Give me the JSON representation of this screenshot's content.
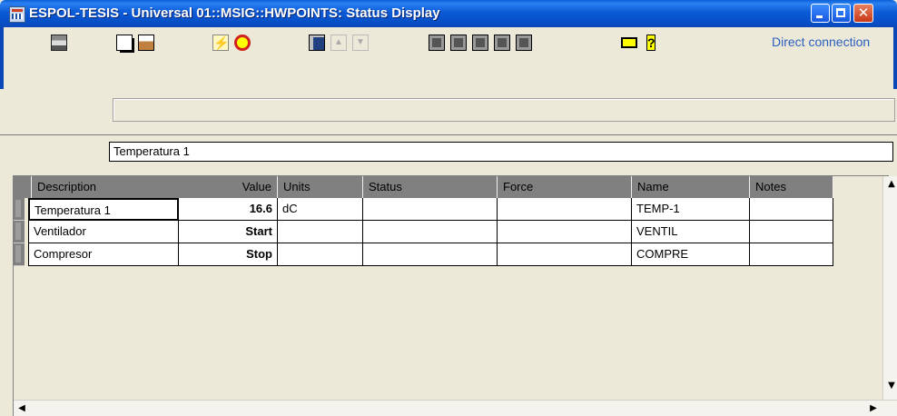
{
  "window": {
    "title": "ESPOL-TESIS - Universal 01::MSIG::HWPOINTS: Status Display"
  },
  "toolbar": {
    "connection_label": "Direct connection"
  },
  "filter": {
    "value": "Temperatura 1"
  },
  "table": {
    "columns": [
      "Description",
      "Value",
      "Units",
      "Status",
      "Force",
      "Name",
      "Notes"
    ],
    "rows": [
      {
        "description": "Temperatura 1",
        "value": "16.6",
        "units": "dC",
        "status": "",
        "force": "",
        "name": "TEMP-1",
        "notes": ""
      },
      {
        "description": "Ventilador",
        "value": "Start",
        "units": "",
        "status": "",
        "force": "",
        "name": "VENTIL",
        "notes": ""
      },
      {
        "description": "Compresor",
        "value": "Stop",
        "units": "",
        "status": "",
        "force": "",
        "name": "COMPRE",
        "notes": ""
      }
    ]
  }
}
